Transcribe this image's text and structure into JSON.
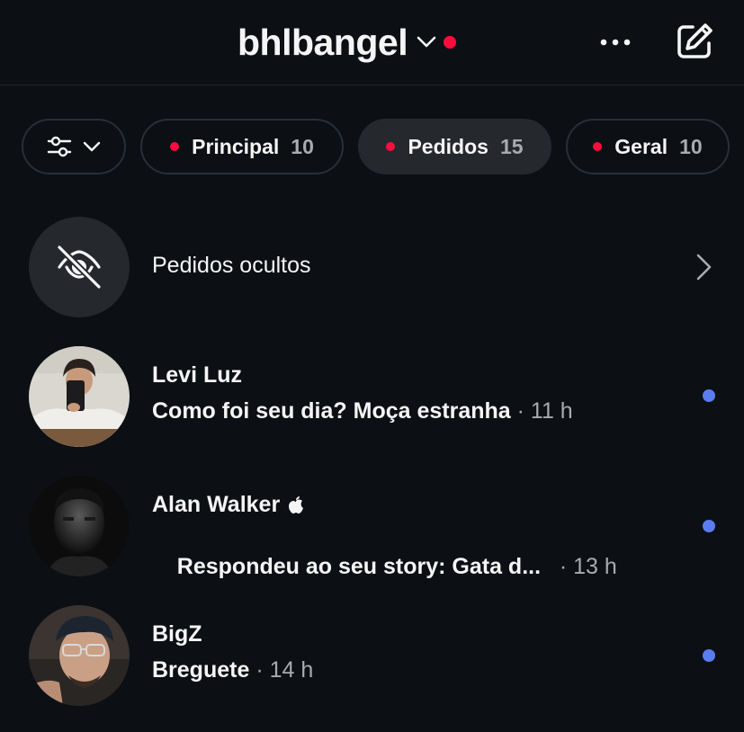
{
  "header": {
    "username": "bhlbangel",
    "icons": {
      "chevron": "chevron-down-icon",
      "more": "more-horizontal-icon",
      "compose": "compose-icon"
    }
  },
  "colors": {
    "background": "#0c1014",
    "notification_red": "#ff0c3e",
    "unread_blue": "#5b7cf0",
    "chip_active": "#25292e",
    "muted_text": "#a8abaf"
  },
  "filters": {
    "filter_icon": "sliders-icon",
    "chips": [
      {
        "label": "Principal",
        "count": "10"
      },
      {
        "label": "Pedidos",
        "count": "15",
        "active": true
      },
      {
        "label": "Geral",
        "count": "10"
      }
    ]
  },
  "hidden_requests": {
    "label": "Pedidos ocultos",
    "icon": "eye-off-icon"
  },
  "messages": [
    {
      "name": "Levi Luz",
      "preview": "Como foi seu dia? Moça estranha",
      "time": " · 11 h",
      "unread": true
    },
    {
      "name": "Alan Walker",
      "verified_icon": "apple-icon",
      "preview": "Respondeu ao seu story: Gata d...",
      "time": "   · 13 h",
      "unread": true
    },
    {
      "name": "BigZ",
      "preview": "Breguete",
      "time": " · 14 h",
      "unread": true
    }
  ]
}
